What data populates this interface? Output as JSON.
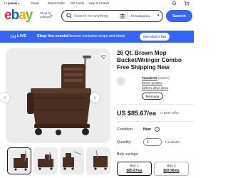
{
  "topnav": {
    "greeting_prefix": "Hi",
    "greeting_name": "jameel",
    "deals": "Deals",
    "brand_outlet": "Brand Outlet",
    "gift_cards": "Gift Cards",
    "help_contact": "Help & Contact"
  },
  "header": {
    "shop_by_line1": "Shop by",
    "shop_by_line2": "category",
    "search_placeholder": "Search for anything",
    "category_select": "All Categories",
    "search_button": "Search"
  },
  "banner": {
    "live_label": "LIVE",
    "title": "Shop live events",
    "description": "Discover exclusive drops and deals",
    "button": "See what's live",
    "color": "#3665f3"
  },
  "product": {
    "title": "26 Qt. Brown Mop Bucket/Wringer Combo Free Shipping New",
    "price": "US $85.67/ea",
    "best_offer": "or Best Offer",
    "condition_label": "Condition:",
    "condition_value": "New",
    "quantity_label": "Quantity:",
    "quantity_value": "1",
    "available_text": "7 available",
    "bulk_label": "Bulk savings:",
    "bulk_options": [
      {
        "qty": "Buy 1",
        "price": "$85.67/ea"
      },
      {
        "qty": "Buy 2",
        "price": "$83.96/ea"
      }
    ]
  },
  "seller": {
    "name": "TexedoTS",
    "feedback_count": "(23547)",
    "positive": "99.5% positive",
    "other_items": "Seller's other items",
    "message_button": "Message"
  },
  "icons": {
    "cart": "cart-icon",
    "bell": "bell-icon",
    "heart": "heart-icon"
  }
}
